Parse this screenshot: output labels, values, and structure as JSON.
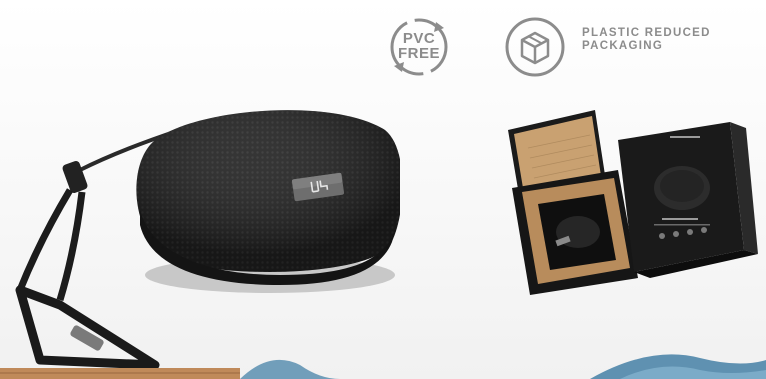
{
  "badges": {
    "pvc": {
      "line1": "PVC",
      "line2": "FREE",
      "icon": "recycle-arrows-icon"
    },
    "plastic": {
      "line1": "PLASTIC REDUCED",
      "line2": "PACKAGING",
      "icon": "open-box-icon"
    }
  },
  "colors": {
    "speaker": "#1b1b1b",
    "badge_gray": "#8c8c8c",
    "box_black": "#1a1a1a",
    "cardboard": "#c49a6b",
    "water_blue": "#5b8fb0",
    "wood": "#c08a5a"
  }
}
